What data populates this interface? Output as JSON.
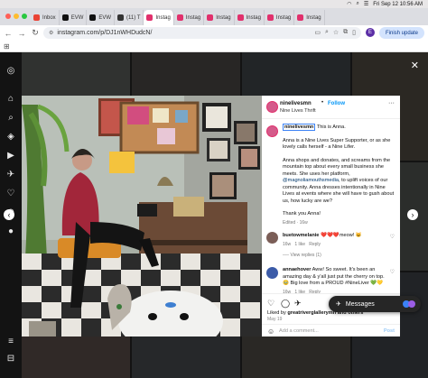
{
  "menubar": {
    "datetime": "Fri Sep 12  10:56 AM"
  },
  "browser": {
    "tabs": [
      {
        "label": "Inbox",
        "color": "#ea4335"
      },
      {
        "label": "EVW",
        "color": "#111111"
      },
      {
        "label": "EVW",
        "color": "#111111"
      },
      {
        "label": "(11) T",
        "color": "#333333"
      },
      {
        "label": "Instag",
        "color": "#e1306c"
      },
      {
        "label": "Instag",
        "color": "#e1306c"
      },
      {
        "label": "Instag",
        "color": "#e1306c"
      },
      {
        "label": "Instag",
        "color": "#e1306c"
      },
      {
        "label": "Instag",
        "color": "#e1306c"
      },
      {
        "label": "Instag",
        "color": "#e1306c"
      }
    ],
    "url": "instagram.com/p/DJ1nWHDudcN/",
    "profile_initial": "E",
    "finish_update": "Finish update"
  },
  "post": {
    "username": "ninelivesmn",
    "follow": "Follow",
    "location": "Nine Lives Thrift",
    "caption": {
      "mention": "ninelivesmn",
      "title": "This is Anna.",
      "para1": "Anna is a Nine Lives Super Supporter, or as she lovely calls herself - a Nine Lifer.",
      "para2a": "Anna shops and donates, and screams from the mountain top about every small business she meets. She uses her platform,",
      "para2link": "@magnoliamouthsmedia",
      "para2b": ", to uplift voices of our community. Anna dresses intentionally in Nine Lives at events where she will have to gush about us, how lucky are we?",
      "para3": "Thank you Anna!",
      "meta": "Edited · 16w"
    },
    "comments": [
      {
        "user": "buetowmelanie",
        "text": "❤️❤️❤️meow! 😺",
        "time": "16w",
        "likes": "1 like",
        "reply": "Reply",
        "view_replies": "View replies (1)"
      },
      {
        "user": "annaehover",
        "text": "Aww! So sweet. It's been an amazing day & y'all just put the cherry on top. 🥹 Big love from a PROUD #NineLiver 💚💛",
        "time": "16w",
        "likes": "1 like",
        "reply": "Reply"
      }
    ],
    "liked_by_prefix": "Liked by ",
    "liked_by_user": "greatriverglallerymn",
    "liked_by_suffix": " and others",
    "date": "May 19",
    "add_comment": "Add a comment...",
    "post_button": "Post"
  },
  "messages": {
    "label": "Messages"
  },
  "colors": {
    "instagram_blue": "#0095f6",
    "accent_pink": "#e1306c"
  }
}
